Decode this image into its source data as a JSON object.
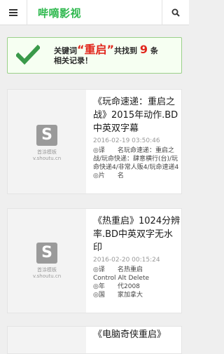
{
  "header": {
    "menu_icon": "hamburger-icon",
    "logo": "哔嘀影视",
    "search_icon": "search-icon"
  },
  "notice": {
    "prefix": "关键词",
    "keyword": "“重启”",
    "middle": "共找到",
    "count": "9",
    "suffix": "条",
    "line2": "相关记录！"
  },
  "thumb": {
    "site": "首涂模板",
    "url": "v.shoutu.cn"
  },
  "results": [
    {
      "title": "《玩命速递：重启之战》2015年动作.BD中英双字幕",
      "date": "2016-02-19 03:50:46",
      "meta": [
        {
          "label": "◎译　　名",
          "value": "玩命速递：重启之战/玩命快递：肆意横行(台)/玩命快递4/非常人贩4/玩命速递4"
        },
        {
          "label": "◎片　　名",
          "value": ""
        }
      ]
    },
    {
      "title": "《热重启》1024分辨率.BD中英双字无水印",
      "date": "2016-02-20 00:15:24",
      "meta": [
        {
          "label": "◎译　　名",
          "value": "热重启"
        },
        {
          "label": "",
          "value": "Control Alt Delete"
        },
        {
          "label": "◎年　　代",
          "value": "2008"
        },
        {
          "label": "◎国　　家",
          "value": "加拿大"
        }
      ]
    },
    {
      "title": "《电脑奇侠重启》",
      "date": "",
      "meta": []
    }
  ]
}
